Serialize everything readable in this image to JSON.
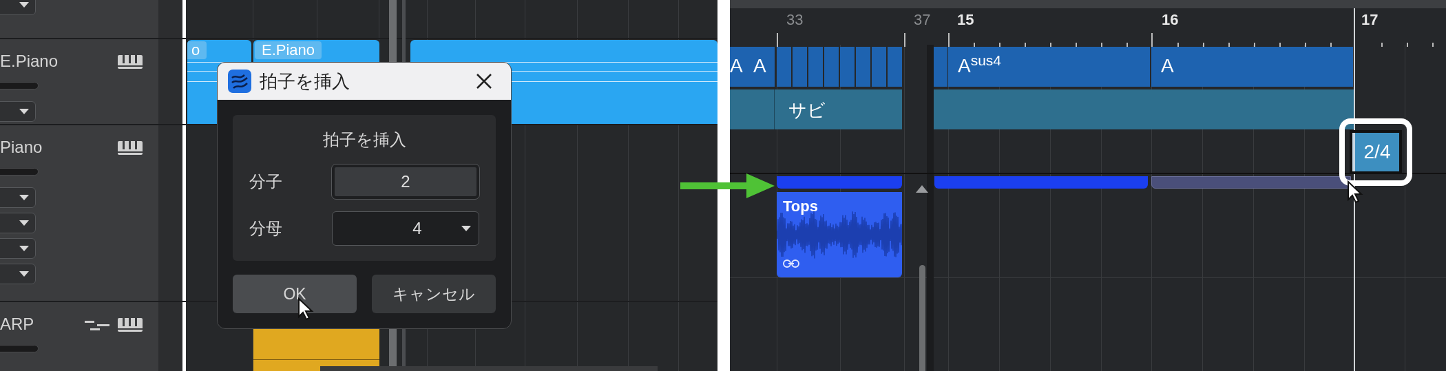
{
  "left_screen": {
    "tracks": [
      {
        "name": "E.Piano",
        "kind": "instrument"
      },
      {
        "name": "Piano",
        "kind": "instrument"
      },
      {
        "name": "ARP",
        "kind": "arp"
      }
    ],
    "clips": [
      {
        "label": "o",
        "kind": "blue"
      },
      {
        "label": "E.Piano",
        "kind": "blue"
      },
      {
        "kind": "blue"
      },
      {
        "kind": "yellow"
      }
    ],
    "dialog": {
      "title": "拍子を挿入",
      "heading": "拍子を挿入",
      "fields": [
        {
          "label": "分子",
          "value": "2",
          "kind": "text"
        },
        {
          "label": "分母",
          "value": "4",
          "kind": "select"
        }
      ],
      "buttons": [
        {
          "label": "OK",
          "hovered": true
        },
        {
          "label": "キャンセル",
          "hovered": false
        }
      ]
    }
  },
  "right_screen": {
    "ruler": [
      {
        "text": "33",
        "dim": true
      },
      {
        "text": "37",
        "dim": true
      },
      {
        "text": "15",
        "dim": false
      },
      {
        "text": "16",
        "dim": false
      },
      {
        "text": "17",
        "dim": false
      }
    ],
    "chords": [
      "A",
      "A",
      "A$^{sus4}$",
      "A"
    ],
    "arranger": [
      "サビ"
    ],
    "signature_marker": {
      "text": "2/4",
      "highlighted": true
    },
    "audio_clip": {
      "name": "Tops"
    }
  }
}
